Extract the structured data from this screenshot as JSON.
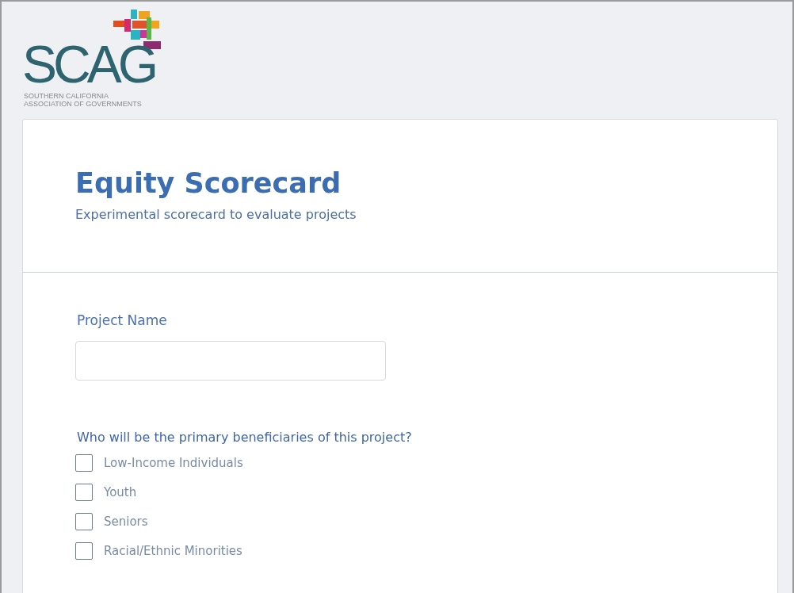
{
  "header": {
    "logo": {
      "wordmark": "SCAG",
      "tagline": [
        "SOUTHERN CALIFORNIA",
        "ASSOCIATION OF GOVERNMENTS"
      ]
    }
  },
  "form": {
    "title": "Equity Scorecard",
    "subtitle": "Experimental scorecard to evaluate projects",
    "fields": [
      {
        "label": "Project Name"
      }
    ],
    "question": "Who will be the primary beneficiaries of this project?",
    "options": [
      {
        "label": "Low-Income Individuals",
        "checked": false
      },
      {
        "label": "Youth",
        "checked": false
      },
      {
        "label": "Seniors",
        "checked": false
      },
      {
        "label": "Racial/Ethnic Minorities",
        "checked": false
      }
    ]
  }
}
